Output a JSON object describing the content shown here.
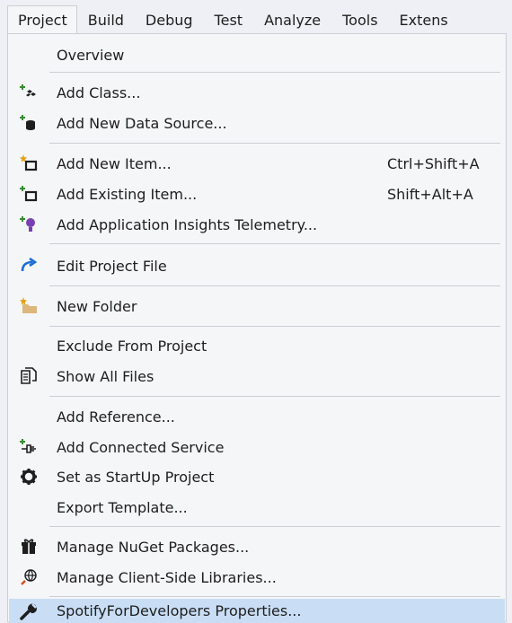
{
  "menubar": {
    "items": [
      "Project",
      "Build",
      "Debug",
      "Test",
      "Analyze",
      "Tools",
      "Extens"
    ]
  },
  "menu": {
    "items": [
      {
        "label": "Overview",
        "shortcut": "",
        "icon": ""
      },
      {
        "label": "Add Class...",
        "shortcut": "",
        "icon": "add-class-icon"
      },
      {
        "label": "Add New Data Source...",
        "shortcut": "",
        "icon": "add-data-source-icon"
      },
      {
        "label": "Add New Item...",
        "shortcut": "Ctrl+Shift+A",
        "icon": "add-new-item-icon"
      },
      {
        "label": "Add Existing Item...",
        "shortcut": "Shift+Alt+A",
        "icon": "add-existing-item-icon"
      },
      {
        "label": "Add Application Insights Telemetry...",
        "shortcut": "",
        "icon": "app-insights-icon"
      },
      {
        "label": "Edit Project File",
        "shortcut": "",
        "icon": "edit-project-file-icon"
      },
      {
        "label": "New Folder",
        "shortcut": "",
        "icon": "new-folder-icon"
      },
      {
        "label": "Exclude From Project",
        "shortcut": "",
        "icon": ""
      },
      {
        "label": "Show All Files",
        "shortcut": "",
        "icon": "show-all-files-icon"
      },
      {
        "label": "Add Reference...",
        "shortcut": "",
        "icon": ""
      },
      {
        "label": "Add Connected Service",
        "shortcut": "",
        "icon": "connected-service-icon"
      },
      {
        "label": "Set as StartUp Project",
        "shortcut": "",
        "icon": "gear-icon"
      },
      {
        "label": "Export Template...",
        "shortcut": "",
        "icon": ""
      },
      {
        "label": "Manage NuGet Packages...",
        "shortcut": "",
        "icon": "nuget-icon"
      },
      {
        "label": "Manage Client-Side Libraries...",
        "shortcut": "",
        "icon": "client-libraries-icon"
      },
      {
        "label": "SpotifyForDevelopers Properties...",
        "shortcut": "",
        "icon": "wrench-icon"
      }
    ]
  },
  "colors": {
    "highlight": "#c9def5",
    "accent_green": "#388a34",
    "accent_blue": "#1e6fd4",
    "folder": "#dcb67a"
  }
}
